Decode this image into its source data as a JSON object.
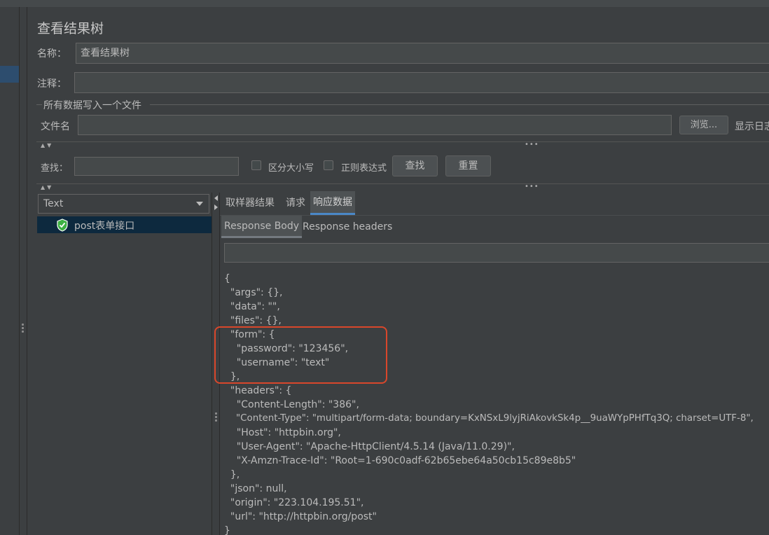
{
  "window": {
    "title": "查看结果树"
  },
  "form": {
    "name_label": "名称：",
    "name_value": "查看结果树",
    "comment_label": "注释：",
    "comment_value": "",
    "group_title": "所有数据写入一个文件",
    "filename_label": "文件名",
    "filename_value": "",
    "browse_label": "浏览...",
    "show_log_label": "显示日志"
  },
  "search": {
    "label": "查找：",
    "value": "",
    "case_label": "区分大小写",
    "case_checked": false,
    "regex_label": "正则表达式",
    "regex_checked": false,
    "find_label": "查找",
    "reset_label": "重置"
  },
  "tree": {
    "renderer": "Text",
    "items": [
      {
        "label": "post表单接口",
        "status": "success"
      }
    ]
  },
  "tabs": [
    {
      "label": "取样器结果",
      "active": false
    },
    {
      "label": "请求",
      "active": false
    },
    {
      "label": "响应数据",
      "active": true
    }
  ],
  "subtabs": [
    {
      "label": "Response Body",
      "active": true
    },
    {
      "label": "Response headers",
      "active": false
    }
  ],
  "response_lines": [
    "{",
    "  \"args\": {},",
    "  \"data\": \"\",",
    "  \"files\": {},",
    "  \"form\": {",
    "    \"password\": \"123456\",",
    "    \"username\": \"text\"",
    "  },",
    "  \"headers\": {",
    "    \"Content-Length\": \"386\",",
    "    \"Content-Type\": \"multipart/form-data; boundary=KxNSxL9lyjRiAkovkSk4p__9uaWYpPHfTq3Q; charset=UTF-8\",",
    "    \"Host\": \"httpbin.org\",",
    "    \"User-Agent\": \"Apache-HttpClient/4.5.14 (Java/11.0.29)\",",
    "    \"X-Amzn-Trace-Id\": \"Root=1-690c0adf-62b65ebe64a50cb15c89e8b5\"",
    "  },",
    "  \"json\": null,",
    "  \"origin\": \"223.104.195.51\",",
    "  \"url\": \"http://httpbin.org/post\"",
    "}"
  ],
  "colors": {
    "background": "#3c3f41",
    "field": "#45494a",
    "selection": "#0d293e",
    "tab_underline": "#4a88c7",
    "highlight_box": "#d9472b",
    "success_icon": "#3cb043"
  }
}
